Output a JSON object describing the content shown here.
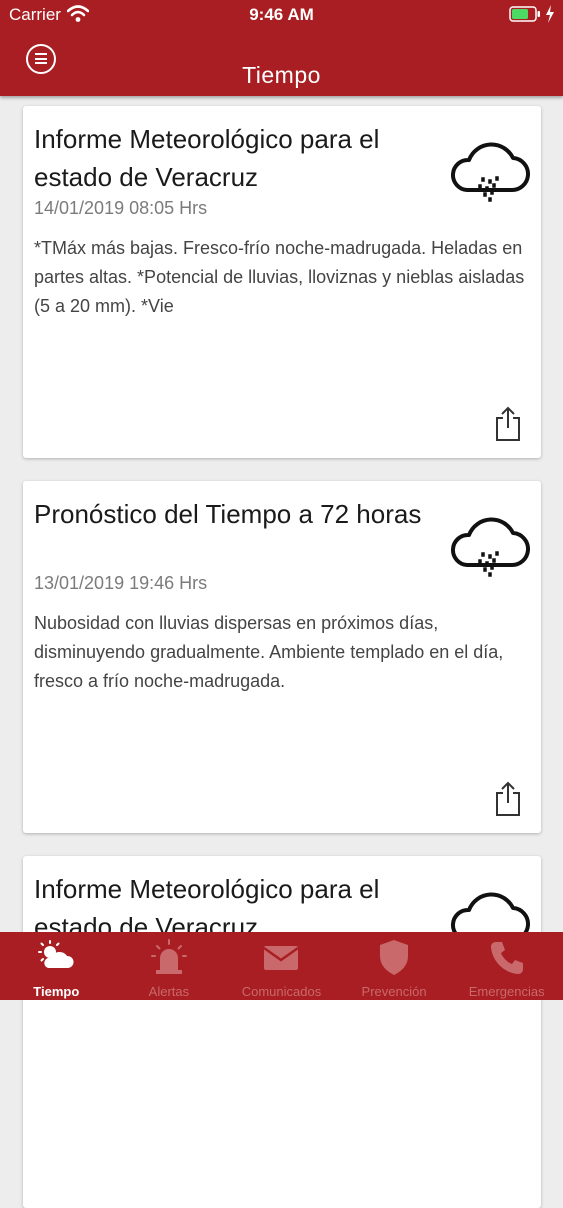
{
  "status": {
    "carrier": "Carrier",
    "time": "9:46 AM"
  },
  "header": {
    "title": "Tiempo"
  },
  "cards": [
    {
      "title": "Informe Meteorológico para el estado de Veracruz",
      "date": "14/01/2019 08:05 Hrs",
      "text": "*TMáx más bajas. Fresco-frío noche-madrugada. Heladas en partes altas. *Potencial de lluvias, lloviznas y nieblas aisladas (5 a 20 mm). *Vie",
      "icon": "rain-cloud-icon"
    },
    {
      "title": "Pronóstico del Tiempo a 72 horas",
      "date": "13/01/2019 19:46 Hrs",
      "text": "Nubosidad con lluvias dispersas en próximos días, disminuyendo gradualmente. Ambiente templado en el día, fresco a frío noche-madrugada.",
      "icon": "rain-cloud-icon"
    },
    {
      "title": "Informe Meteorológico para el estado de Veracruz",
      "date": "",
      "text": "",
      "icon": "rain-cloud-icon"
    }
  ],
  "tabs": [
    {
      "label": "Tiempo",
      "icon": "sun-cloud-icon",
      "active": true
    },
    {
      "label": "Alertas",
      "icon": "siren-icon",
      "active": false
    },
    {
      "label": "Comunicados",
      "icon": "envelope-icon",
      "active": false
    },
    {
      "label": "Prevención",
      "icon": "shield-icon",
      "active": false
    },
    {
      "label": "Emergencias",
      "icon": "phone-icon",
      "active": false
    }
  ],
  "colors": {
    "primary": "#a81e22",
    "background": "#ededed",
    "tab_inactive": "#c9696b"
  }
}
